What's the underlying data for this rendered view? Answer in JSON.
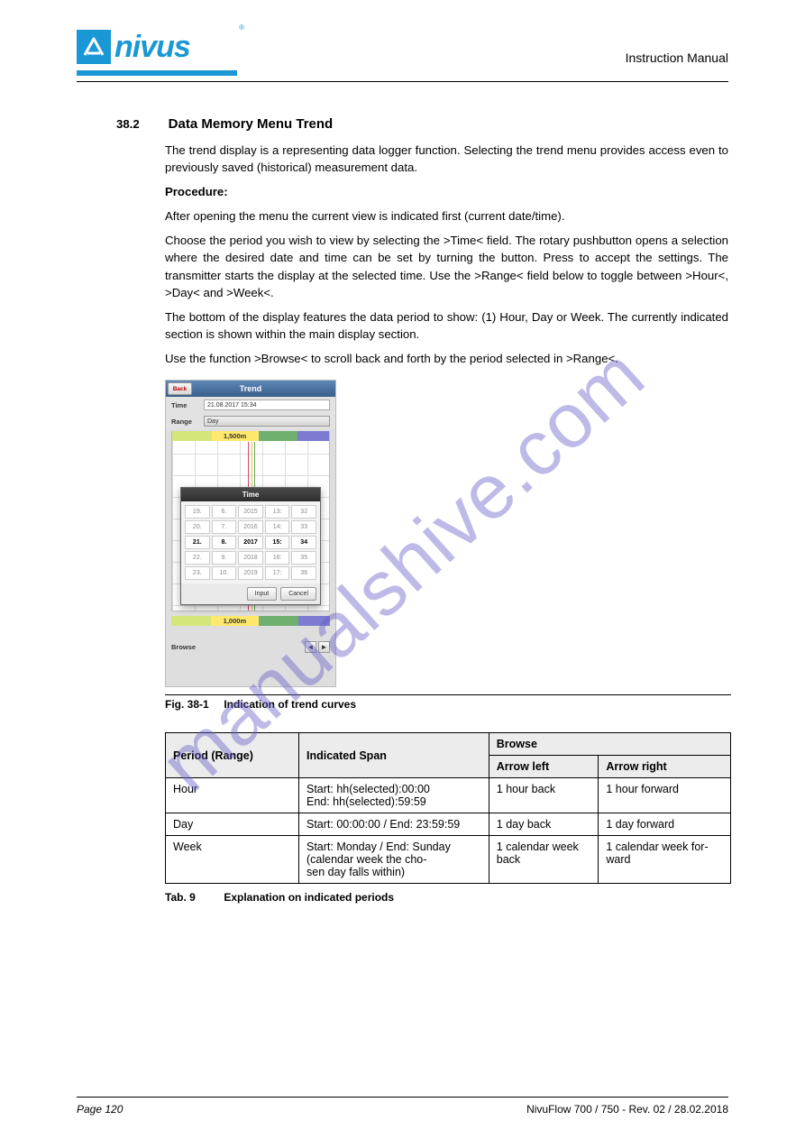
{
  "logo": {
    "text": "nivus",
    "reg": "®"
  },
  "header_right": "Instruction Manual",
  "section": {
    "num": "38.2",
    "title": "Data Memory Menu Trend"
  },
  "p1": "The trend display is a representing data logger function. Selecting the trend menu provides access even to previously saved (historical) measurement data.",
  "p2_label": "Procedure:",
  "p2_items": [
    "After opening the menu the current view is indicated first (current date/time).",
    "Choose the period you wish to view by selecting the >Time< field. The rotary pushbutton opens a selection where the desired date and time can be set by turning the button. Press to accept the settings. The transmitter starts the display at the selected time. Use the >Range< field below to toggle between >Hour<, >Day< and >Week<.",
    "The bottom of the display features the data period to show: (1) Hour, Day or Week. The currently indicated section is shown within the main display section.",
    "Use the function >Browse< to scroll back and forth by the period selected in >Range<."
  ],
  "screenshot": {
    "back": "Back",
    "title": "Trend",
    "time_label": "Time",
    "time_value": "21.08.2017 15:34",
    "range_label": "Range",
    "range_value": "Day",
    "top_val": "1,500m",
    "bot_val": "1,000m",
    "popup_title": "Time",
    "grid": [
      [
        "19.",
        "6.",
        "2015",
        "13:",
        "32"
      ],
      [
        "20.",
        "7.",
        "2016",
        "14:",
        "33"
      ],
      [
        "21.",
        "8.",
        "2017",
        "15:",
        "34"
      ],
      [
        "22.",
        "9.",
        "2018",
        "16:",
        "35"
      ],
      [
        "23.",
        "10.",
        "2019",
        "17:",
        "36"
      ]
    ],
    "on_row": 2,
    "input_btn": "Input",
    "cancel_btn": "Cancel",
    "browse_label": "Browse",
    "arrow_left": "◄",
    "arrow_right": "►"
  },
  "figure": {
    "num": "Fig. 38-1",
    "caption": "Indication of trend curves"
  },
  "chart_data": {
    "type": "table",
    "title": "Spans depending on the selected period",
    "columns": [
      "Period (Range)",
      "Arrow left",
      "Arrow right"
    ],
    "rows": [
      {
        "period": "Hour",
        "span": "Start: hh(selected):00:00\nEnd: hh(selected):59:59",
        "left": "1 hour back",
        "right": "1 hour forward"
      },
      {
        "period": "Day",
        "span": "Start: 00:00:00 / End: 23:59:59",
        "left": "1 day back",
        "right": "1 day forward"
      },
      {
        "period": "Week",
        "span": "Start: Monday / End: Sunday\n(calendar week the chosen day falls within)",
        "left": "1 calendar week back",
        "right": "1 calendar week forward"
      }
    ]
  },
  "table": {
    "head": {
      "c1": "Period (Range)",
      "c2": "Indicated Span",
      "c3": "Browse",
      "c3a": "Arrow left",
      "c3b": "Arrow right"
    },
    "rows": [
      {
        "c1": "Hour",
        "c2a": "Start: hh(selected):00:00",
        "c2b": "End: hh(selected):59:59",
        "c3a": "1 hour back",
        "c3b": "1 hour forward"
      },
      {
        "c1": "Day",
        "c2": "Start: 00:00:00 / End: 23:59:59",
        "c3a": "1 day back",
        "c3b": "1 day forward"
      },
      {
        "c1": "Week",
        "c2a": "Start: Monday / End: Sunday",
        "c2b": "(calendar week the cho-",
        "c2c": "sen day falls within)",
        "c3a_a": "1 calendar week",
        "c3a_b": "back",
        "c3b_a": "1 calendar week for-",
        "c3b_b": "ward"
      }
    ]
  },
  "tab_caption": {
    "num": "Tab. 9",
    "caption": "Explanation on indicated periods"
  },
  "footer": {
    "left": "Page 120",
    "right": "NivuFlow 700 / 750 - Rev. 02 / 28.02.2018"
  },
  "watermark": "manualshive.com"
}
